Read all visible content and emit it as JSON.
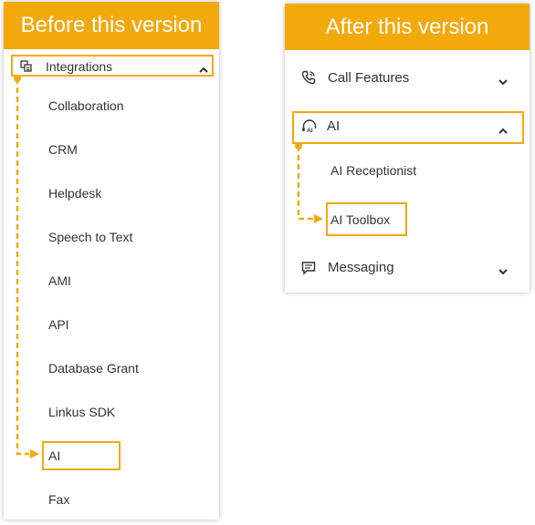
{
  "before": {
    "title": "Before this version",
    "parent_label": "Integrations",
    "items": [
      "Collaboration",
      "CRM",
      "Helpdesk",
      "Speech to Text",
      "AMI",
      "API",
      "Database Grant",
      "Linkus SDK",
      "AI",
      "Fax"
    ]
  },
  "after": {
    "title": "After this version",
    "call_features_label": "Call Features",
    "ai_label": "AI",
    "ai_receptionist_label": "AI Receptionist",
    "ai_toolbox_label": "AI Toolbox",
    "messaging_label": "Messaging"
  },
  "colors": {
    "highlight": "#f2a90c",
    "text": "#333333",
    "header_text": "#ffffff"
  },
  "icons": [
    "integrations-icon",
    "chevron-up-icon",
    "phone-icon",
    "ai-headset-icon",
    "message-icon",
    "chevron-down-icon"
  ]
}
